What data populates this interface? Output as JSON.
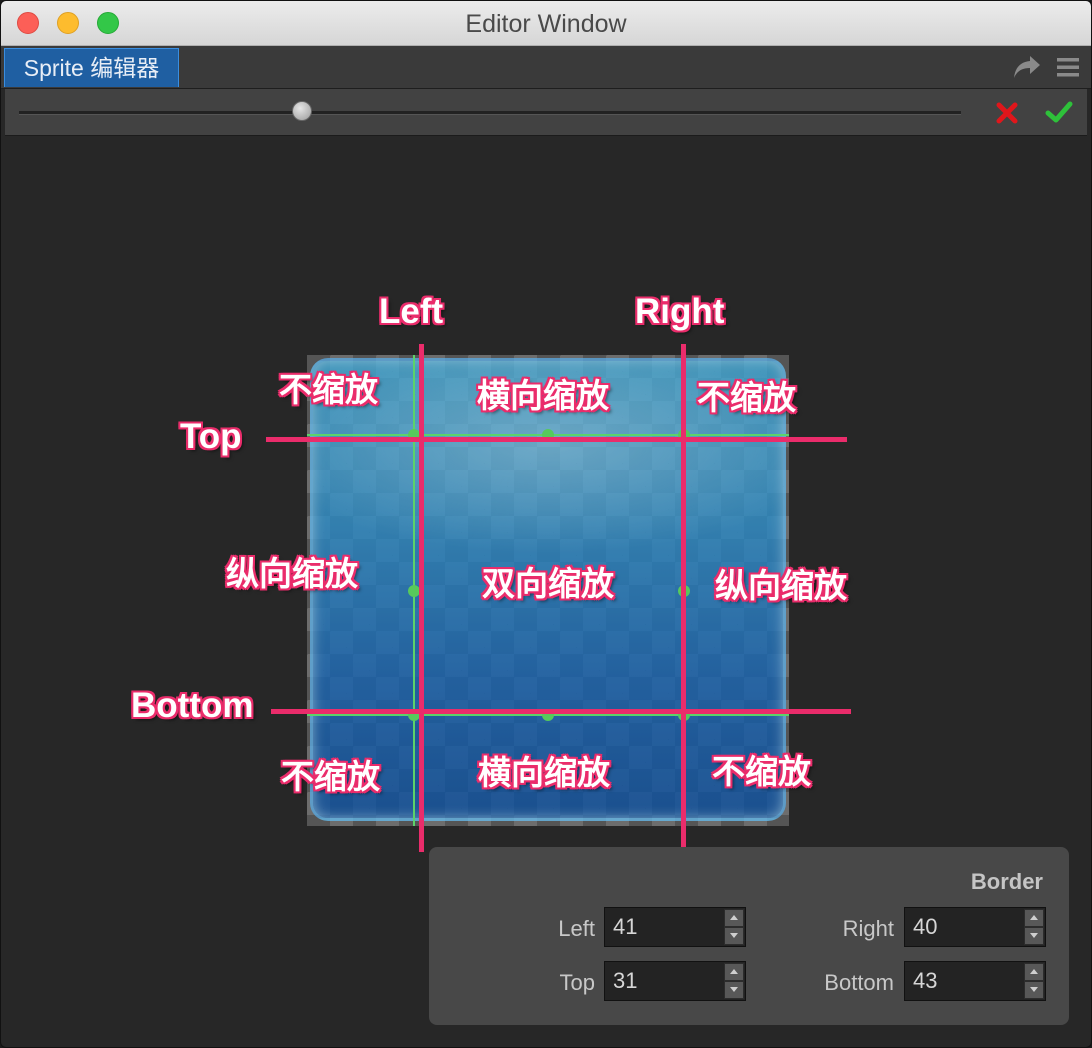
{
  "window": {
    "title": "Editor Window"
  },
  "tabs": [
    {
      "label": "Sprite 编辑器",
      "active": true
    }
  ],
  "toolbar": {
    "zoom_slider_value": 0.3,
    "cancel_icon": "x-icon",
    "confirm_icon": "check-icon",
    "cancel_color": "#e0161b",
    "confirm_color": "#2ec13a"
  },
  "guides": {
    "left": "Left",
    "right": "Right",
    "top": "Top",
    "bottom": "Bottom"
  },
  "zones": {
    "top_left": "不缩放",
    "top_center": "横向缩放",
    "top_right": "不缩放",
    "middle_left": "纵向缩放",
    "center": "双向缩放",
    "middle_right": "纵向缩放",
    "bottom_left": "不缩放",
    "bottom_center": "横向缩放",
    "bottom_right": "不缩放"
  },
  "border_panel": {
    "title": "Border",
    "left_label": "Left",
    "left_value": "41",
    "right_label": "Right",
    "right_value": "40",
    "top_label": "Top",
    "top_value": "31",
    "bottom_label": "Bottom",
    "bottom_value": "43"
  },
  "colors": {
    "annotation": "#ea2c6b",
    "slice_handle": "#57c95c",
    "tab_active": "#1f5fa2"
  }
}
